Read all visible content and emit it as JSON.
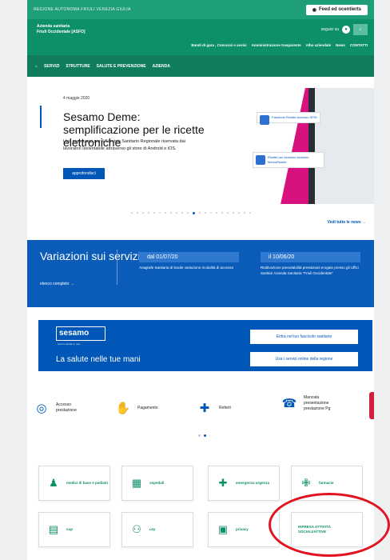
{
  "colors": {
    "green": "#0d8f6a",
    "blue": "#0057b7",
    "highlight": "#e2131f"
  },
  "topbar": {
    "region": "REGIONE AUTONOMA FRIULI VENEZIA GIULIA",
    "feed_label": "Feed ed ocentierts",
    "feed_icon": "rss-icon"
  },
  "header": {
    "brand_line1": "Azienda sanitaria",
    "brand_line2": "Friuli Occidentale [ASFO]",
    "follow": "seguici su",
    "links": [
      "Bandi di gara , Concorsi e avvisi",
      "Amministrazione trasparente",
      "Albo aziendale",
      "News",
      "CONTATTI"
    ]
  },
  "nav": [
    "SERVIZI",
    "STRUTTURE",
    "SALUTE E PREVENZIONE",
    "AZIENDA"
  ],
  "hero": {
    "date": "4 maggio 2020",
    "title": "Sesamo Deme: semplificazione per le ricette elettroniche",
    "desc": "Una nuova app per il Servizio Sanitario Regionale riservata dai lavoratori Iselentabile attraverso gli store di Android e iOS.",
    "button": "approfondisci",
    "card1": "Fascicolo Ricette Accesso SPID",
    "card2": "Ricette per Accesso Accesso MemoRicette",
    "see_all": "Vedi tutte le news →"
  },
  "band": {
    "title": "Variazioni sui servizi",
    "full_list": "elenco completo →",
    "items": [
      {
        "date": "dal 01/07/20",
        "text": "Anagrafe Sanitaria di Sacile variazione modalità di accesso"
      },
      {
        "date": "il 10/06/20",
        "text": "Riattivazione prenotabilità prestazioni erogate presso gli Uffici Sanitari Azienda Sanitaria \"Friuli Occidentale\""
      }
    ]
  },
  "sesamo": {
    "logo": "sesamo",
    "logo_sub": "servizi sanitari in rete",
    "tagline": "La salute nelle tue mani",
    "btn1": "Entra nel tuo fascicolo sanitario",
    "btn2": "Usa i servizi online della regione"
  },
  "services": [
    {
      "label": "Accesso prestazione",
      "icon": "fingerprint-icon"
    },
    {
      "label": "Pagamento",
      "icon": "hand-coin-icon"
    },
    {
      "label": "Referti",
      "icon": "medical-kit-icon"
    },
    {
      "label": "Mancata presentazione prestazione Pg",
      "icon": "telephone-icon"
    }
  ],
  "tiles": [
    {
      "label": "medici di base e pediatri",
      "icon": "doctor-icon"
    },
    {
      "label": "ospedali",
      "icon": "hospital-icon"
    },
    {
      "label": "emergenza urgenza",
      "icon": "ambulance-icon"
    },
    {
      "label": "farmacie",
      "icon": "pharmacy-cross-icon"
    },
    {
      "label": "cup",
      "icon": "document-icon"
    },
    {
      "label": "urp",
      "icon": "people-icon"
    },
    {
      "label": "privacy",
      "icon": "lock-icon"
    },
    {
      "label": "RIPRESA ATTIVITÀ SOCIALI/ATTIVE",
      "icon": ""
    }
  ]
}
